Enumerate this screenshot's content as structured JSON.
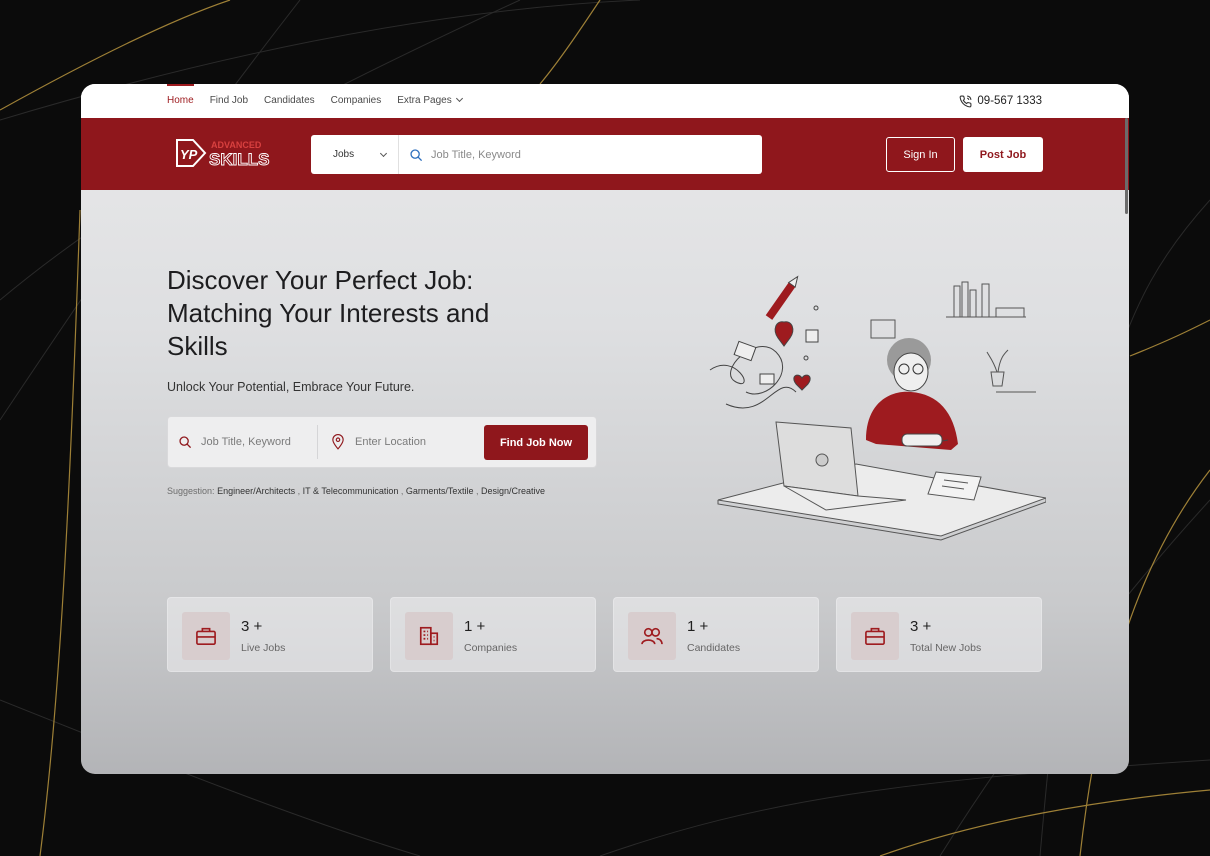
{
  "nav": {
    "links": [
      {
        "label": "Home",
        "active": true
      },
      {
        "label": "Find Job",
        "active": false
      },
      {
        "label": "Candidates",
        "active": false
      },
      {
        "label": "Companies",
        "active": false
      },
      {
        "label": "Extra Pages",
        "active": false,
        "has_dropdown": true
      }
    ],
    "phone": "09-567 1333"
  },
  "header": {
    "logo_text_top": "ADVANCED",
    "logo_text_bottom": "SKILLS",
    "logo_mark": "YP",
    "search_category": "Jobs",
    "search_placeholder": "Job Title, Keyword",
    "signin_label": "Sign In",
    "post_job_label": "Post Job"
  },
  "hero": {
    "title_line1": "Discover Your Perfect Job:",
    "title_line2": "Matching Your Interests and",
    "title_line3": "Skills",
    "subtitle": "Unlock Your Potential, Embrace Your Future.",
    "keyword_placeholder": "Job Title, Keyword",
    "location_placeholder": "Enter Location",
    "find_button": "Find Job Now",
    "suggestion_label": "Suggestion:",
    "suggestions": [
      "Engineer/Architects",
      "IT & Telecommunication",
      "Garments/Textile",
      "Design/Creative"
    ],
    "suggestion_separator": ","
  },
  "stats": [
    {
      "value": "3 +",
      "label": "Live Jobs",
      "icon": "briefcase-icon"
    },
    {
      "value": "1 +",
      "label": "Companies",
      "icon": "building-icon"
    },
    {
      "value": "1 +",
      "label": "Candidates",
      "icon": "users-icon"
    },
    {
      "value": "3 +",
      "label": "Total New Jobs",
      "icon": "briefcase-icon"
    }
  ],
  "colors": {
    "brand_red": "#8f171c",
    "accent_red": "#9e1b1f",
    "background": "#0b0b0b"
  }
}
